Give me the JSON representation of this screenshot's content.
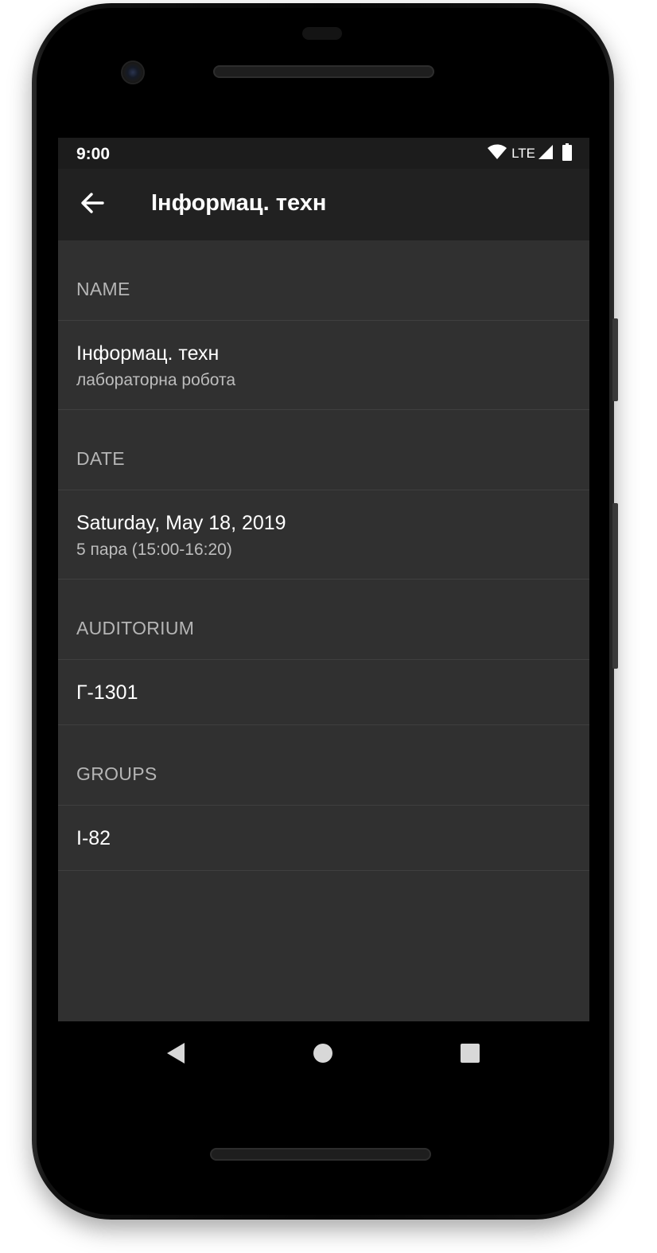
{
  "status_bar": {
    "time": "9:00",
    "network": "LTE",
    "icons": [
      "wifi-icon",
      "cellular-signal-icon",
      "battery-icon"
    ]
  },
  "app_bar": {
    "back_icon": "arrow-back-icon",
    "title": "Інформац. техн"
  },
  "sections": {
    "name": {
      "header": "NAME",
      "primary": "Інформац. техн",
      "secondary": "лабораторна робота"
    },
    "date": {
      "header": "DATE",
      "primary": "Saturday, May 18, 2019",
      "secondary": "5 пара (15:00-16:20)"
    },
    "auditorium": {
      "header": "AUDITORIUM",
      "primary": "Г-1301"
    },
    "groups": {
      "header": "GROUPS",
      "primary": "І-82"
    }
  },
  "nav_bar": {
    "icons": [
      "nav-back-icon",
      "nav-home-icon",
      "nav-recents-icon"
    ]
  },
  "colors": {
    "status_bar_bg": "#1c1c1c",
    "app_bar_bg": "#212121",
    "content_bg": "#303030",
    "primary_text": "#ffffff",
    "header_text": "#b5b5b5",
    "divider": "#3f3f3f"
  }
}
